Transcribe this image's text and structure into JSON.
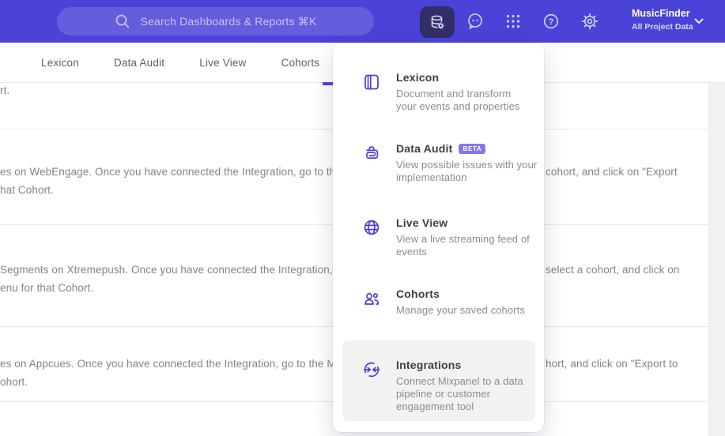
{
  "colors": {
    "header_bg": "#4b43d8",
    "active_button_bg": "#332e69",
    "accent_purple": "#4f44e0",
    "menu_icon_purple": "#4a41d9",
    "beta_badge_bg": "#8677e9",
    "highlight_bg": "#f2f2f3",
    "divider": "#e8e8ea",
    "muted_text": "#83838d"
  },
  "header": {
    "search": {
      "placeholder": "Search Dashboards & Reports ⌘K",
      "icon": "search-icon"
    },
    "icons": [
      "data-management-icon",
      "feedback-bubble-icon",
      "apps-grid-icon",
      "help-icon",
      "settings-gear-icon",
      "chevron-down-icon"
    ],
    "project": {
      "name": "MusicFinder",
      "scope": "All Project Data"
    }
  },
  "tabs": {
    "items": [
      "Lexicon",
      "Data Audit",
      "Live View",
      "Cohorts"
    ]
  },
  "menu": {
    "items": [
      {
        "title": "Lexicon",
        "icon": "book-icon",
        "desc": "Document and transform\nyour events and properties"
      },
      {
        "title": "Data Audit",
        "badge": "BETA",
        "icon": "audit-lock-icon",
        "desc": "View possible issues with your\nimplementation"
      },
      {
        "title": "Live View",
        "icon": "globe-icon",
        "desc": "View a live streaming feed of\nevents"
      },
      {
        "title": "Cohorts",
        "icon": "people-icon",
        "desc": "Manage your saved cohorts"
      },
      {
        "title": "Integrations",
        "icon": "sync-arrows-icon",
        "desc": "Connect Mixpanel to a data\npipeline or customer\nengagement tool",
        "highlighted": true
      }
    ]
  },
  "content": {
    "rows": [
      {
        "left_line1": "rt."
      },
      {
        "left_line1": "es on WebEngage. Once you have connected the Integration, go to the",
        "left_line2": "hat Cohort.",
        "right": "cohort, and click on \"Export"
      },
      {
        "left_line1": "Segments on Xtremepush. Once you have connected the Integration,",
        "left_line2": "enu for that Cohort.",
        "right": "select a cohort, and click on"
      },
      {
        "left_line1": "es on Appcues. Once you have connected the Integration, go to the M",
        "left_line2": "ohort.",
        "right": "hort, and click on \"Export to"
      }
    ]
  }
}
